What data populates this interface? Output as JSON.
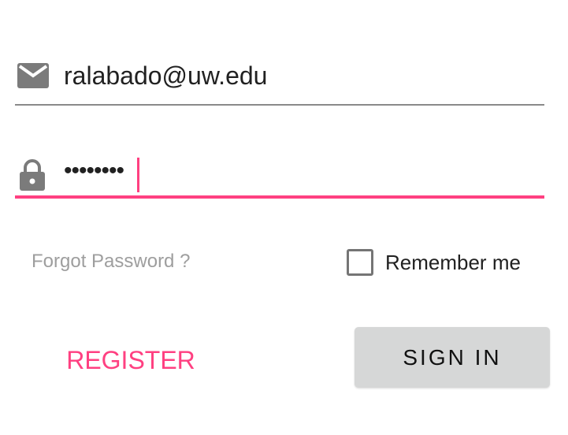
{
  "login_form": {
    "email": {
      "value": "ralabado@uw.edu",
      "icon": "mail-icon"
    },
    "password": {
      "masked_value": "••••••••",
      "icon": "lock-icon",
      "focused": true
    },
    "forgot_password_label": "Forgot Password ?",
    "remember_me": {
      "label": "Remember me",
      "checked": false
    },
    "register_label": "REGISTER",
    "sign_in_label": "SIGN IN"
  },
  "colors": {
    "accent": "#ff4081",
    "icon_gray": "#7b7b7b",
    "text_primary": "#212121",
    "text_hint": "#9e9e9e",
    "button_gray": "#d6d7d7"
  }
}
